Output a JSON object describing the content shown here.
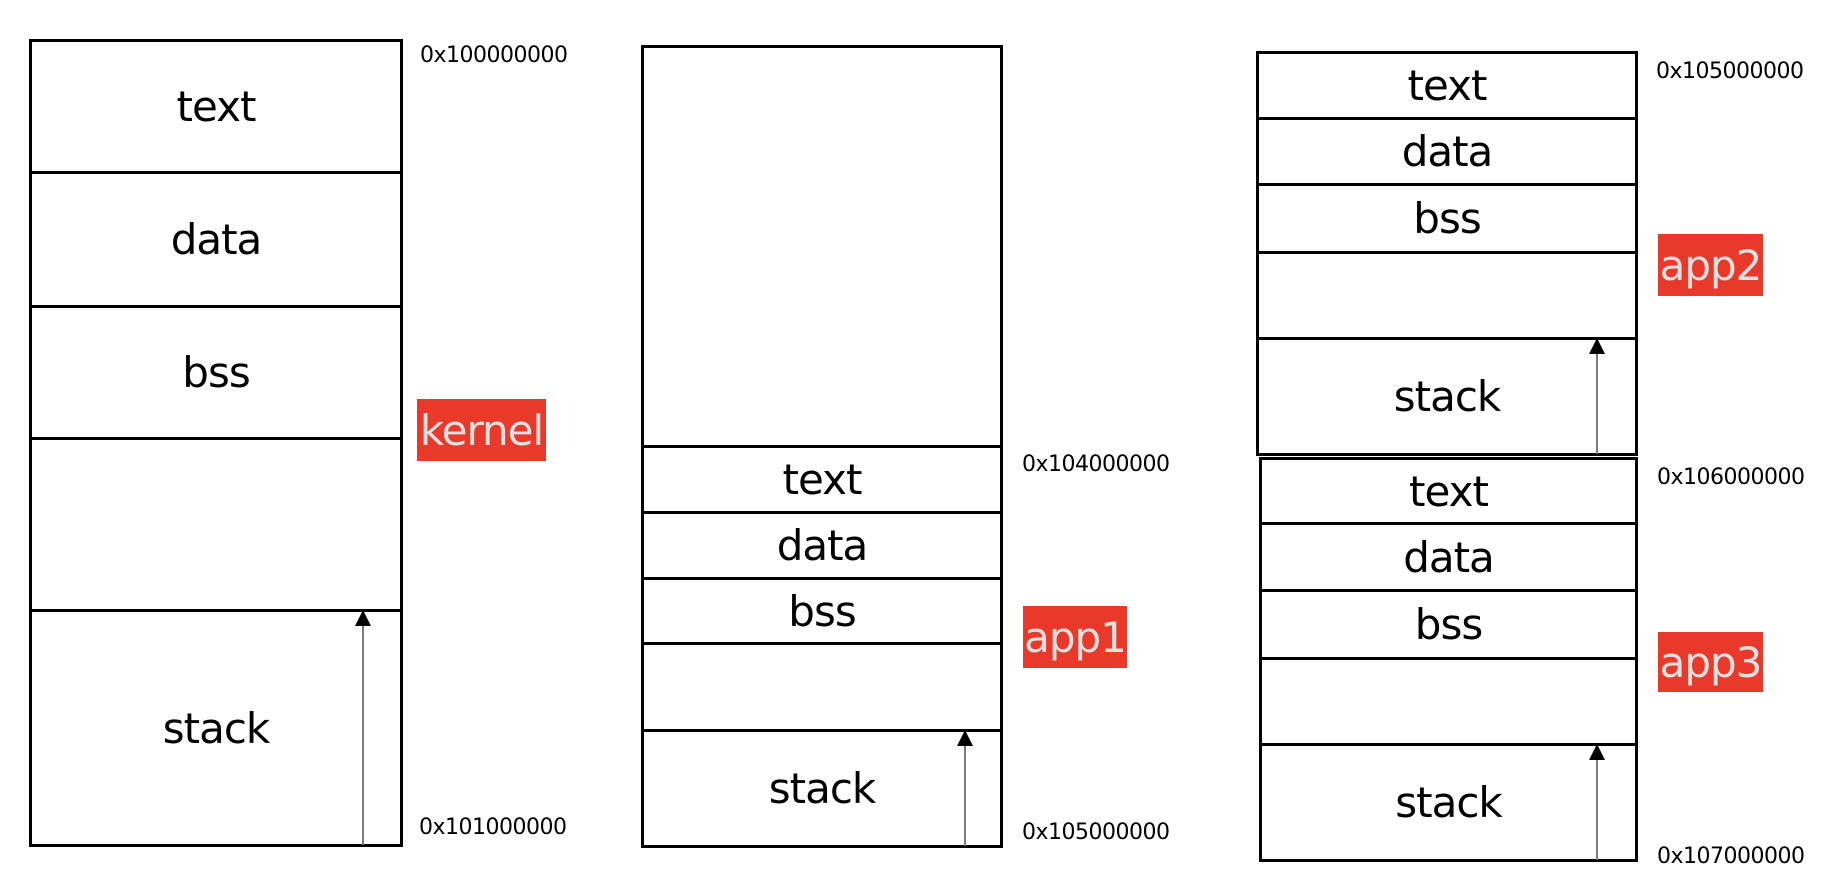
{
  "diagram": {
    "badge_color": "#E8392A",
    "badge_text_color": "#E0E0E0",
    "regions": [
      {
        "name": "kernel",
        "badge": "kernel",
        "start_address": "0x100000000",
        "end_address": "0x101000000",
        "segments": [
          "text",
          "data",
          "bss",
          "",
          "stack"
        ],
        "stack_grows_up": true
      },
      {
        "name": "app1",
        "badge": "app1",
        "start_address": "0x104000000",
        "end_address": "0x105000000",
        "segments": [
          "",
          "text",
          "data",
          "bss",
          "",
          "stack"
        ],
        "stack_grows_up": true
      },
      {
        "name": "app2",
        "badge": "app2",
        "start_address": "0x105000000",
        "end_address": "",
        "segments": [
          "text",
          "data",
          "bss",
          "",
          "stack"
        ],
        "stack_grows_up": true
      },
      {
        "name": "app3",
        "badge": "app3",
        "start_address": "0x106000000",
        "end_address": "0x107000000",
        "segments": [
          "text",
          "data",
          "bss",
          "",
          "stack"
        ],
        "stack_grows_up": true
      }
    ]
  }
}
